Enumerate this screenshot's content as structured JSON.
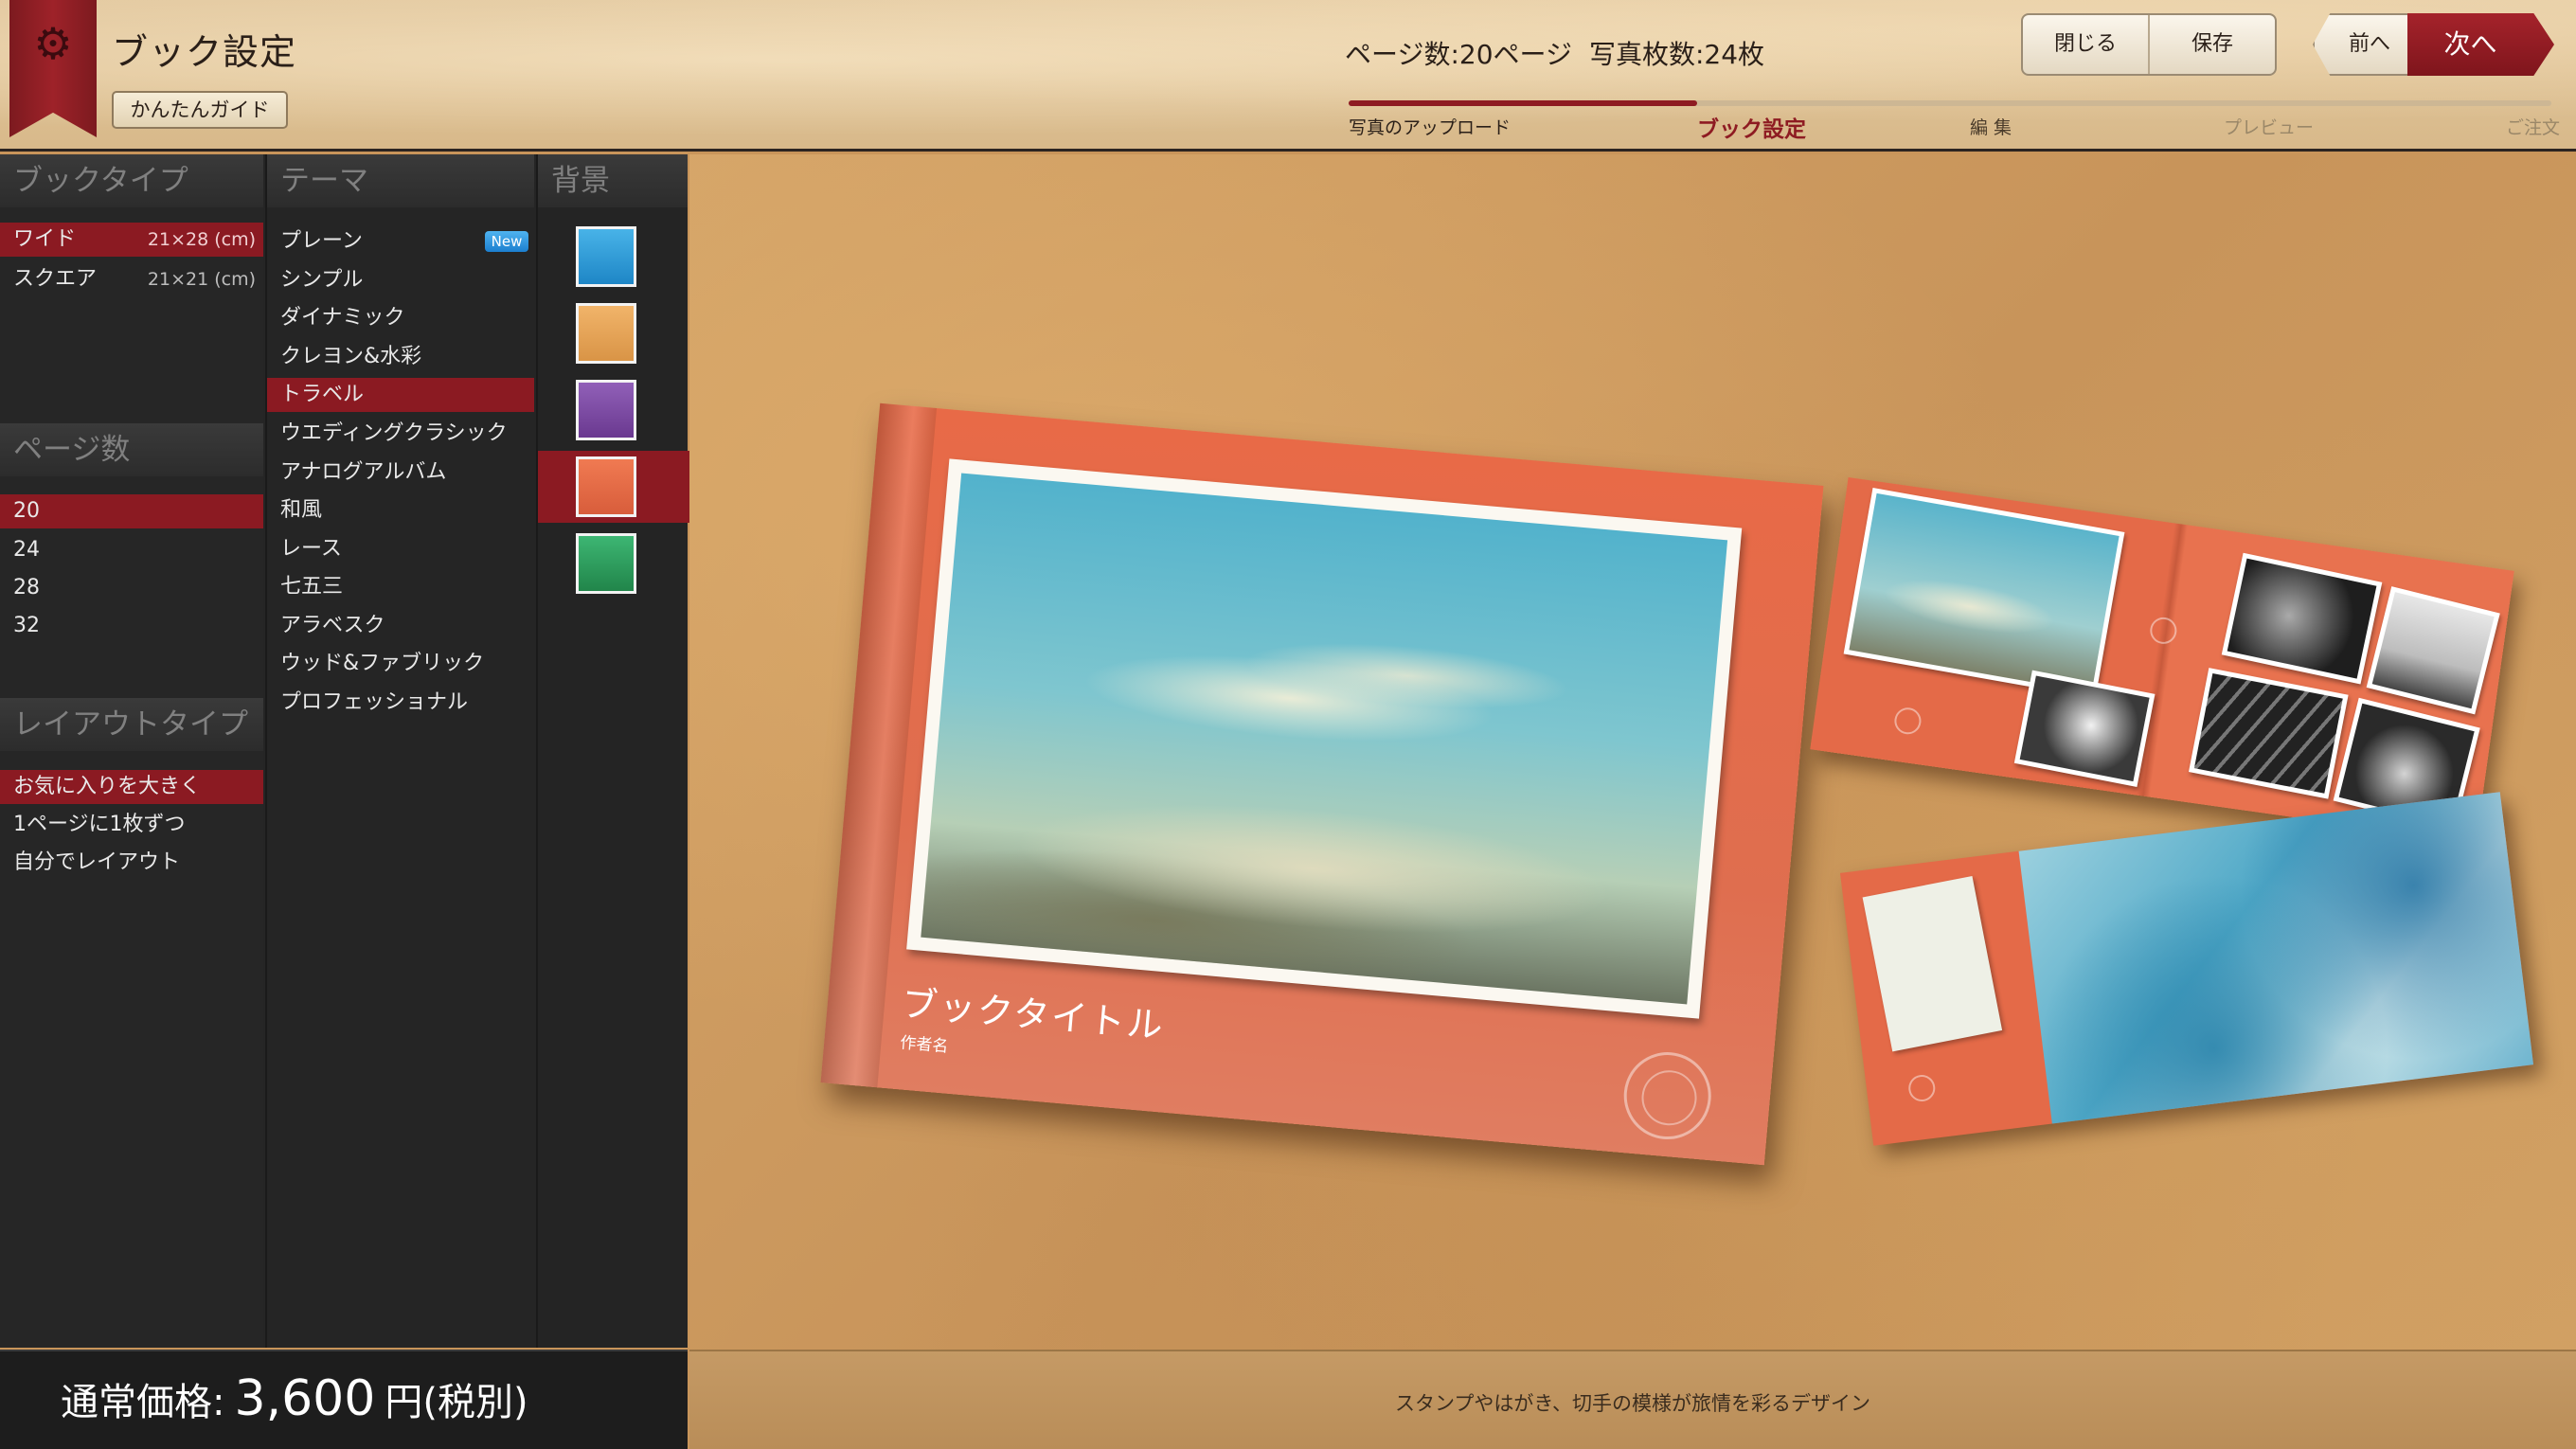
{
  "header": {
    "title": "ブック設定",
    "guide_label": "かんたんガイド",
    "page_count": "ページ数:20ページ",
    "photo_count": "写真枚数:24枚",
    "close_label": "閉じる",
    "save_label": "保存",
    "prev_label": "前へ",
    "next_label": "次へ",
    "steps": [
      "写真のアップロード",
      "ブック設定",
      "編 集",
      "プレビュー",
      "ご注文"
    ],
    "current_step": 1
  },
  "sidebar": {
    "booktype": {
      "heading": "ブックタイプ",
      "items": [
        {
          "label": "ワイド",
          "size": "21×28 (cm)",
          "selected": true
        },
        {
          "label": "スクエア",
          "size": "21×21 (cm)",
          "selected": false
        }
      ]
    },
    "pages": {
      "heading": "ページ数",
      "items": [
        "20",
        "24",
        "28",
        "32"
      ],
      "selected": "20"
    },
    "layout": {
      "heading": "レイアウトタイプ",
      "items": [
        "お気に入りを大きく",
        "1ページに1枚ずつ",
        "自分でレイアウト"
      ],
      "selected": "お気に入りを大きく"
    },
    "theme": {
      "heading": "テーマ",
      "new_badge": "New",
      "items": [
        "プレーン",
        "シンプル",
        "ダイナミック",
        "クレヨン&水彩",
        "トラベル",
        "ウエディングクラシック",
        "アナログアルバム",
        "和風",
        "レース",
        "七五三",
        "アラベスク",
        "ウッド&ファブリック",
        "プロフェッショナル"
      ],
      "selected": "トラベル"
    },
    "background": {
      "heading": "背景",
      "swatches": [
        "#2d9ad6",
        "#e6a25a",
        "#7d4aa3",
        "#e36a45",
        "#2e9b5d"
      ],
      "selected_index": 3
    }
  },
  "price": {
    "label": "通常価格:",
    "amount": "3,600",
    "unit": "円(税別)"
  },
  "preview": {
    "cover_title": "ブックタイトル",
    "cover_author": "作者名",
    "caption": "スタンプやはがき、切手の模様が旅情を彩るデザイン"
  },
  "colors": {
    "accent": "#8b1a22",
    "cover": "#e36a45",
    "sidebar_bg": "#252525"
  }
}
